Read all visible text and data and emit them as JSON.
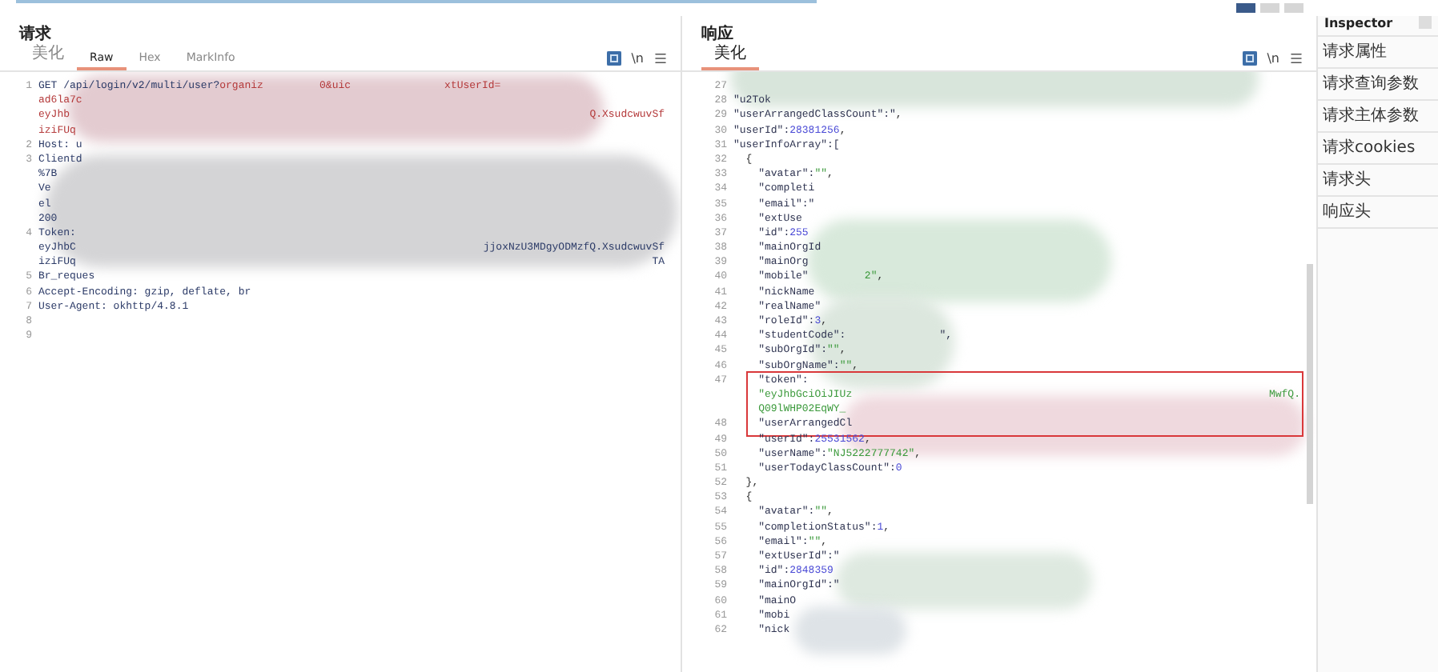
{
  "request": {
    "title": "请求",
    "tabs": [
      {
        "label": "美化",
        "selected": false
      },
      {
        "label": "Raw",
        "selected": true
      },
      {
        "label": "Hex",
        "selected": false
      },
      {
        "label": "MarkInfo",
        "selected": false
      }
    ],
    "toolbar": {
      "newline_toggle": "\\n"
    },
    "rows": [
      {
        "number": "1",
        "parts": [
          {
            "kind": "plain",
            "text": "GET /api/login/v2/multi/user?"
          },
          {
            "kind": "red",
            "text": "organiz         0&uic               xtUserId="
          }
        ]
      },
      {
        "parts": [
          {
            "kind": "red",
            "text": "ad6la7c"
          }
        ]
      },
      {
        "parts": [
          {
            "kind": "red",
            "text": "eyJhb"
          }
        ],
        "tail": {
          "kind": "red",
          "text": "Q.XsudcwuvSf"
        }
      },
      {
        "parts": [
          {
            "kind": "red",
            "text": "iziFUq"
          }
        ]
      },
      {
        "number": "2",
        "parts": [
          {
            "kind": "plain",
            "text": "Host: u"
          }
        ]
      },
      {
        "number": "3",
        "parts": [
          {
            "kind": "plain",
            "text": "Clientd"
          }
        ]
      },
      {
        "parts": [
          {
            "kind": "plain",
            "text": "%7B"
          }
        ]
      },
      {
        "parts": [
          {
            "kind": "plain",
            "text": "Ve"
          }
        ]
      },
      {
        "parts": [
          {
            "kind": "plain",
            "text": "el"
          }
        ]
      },
      {
        "parts": [
          {
            "kind": "plain",
            "text": "200"
          }
        ]
      },
      {
        "number": "4",
        "parts": [
          {
            "kind": "plain",
            "text": "Token:"
          }
        ]
      },
      {
        "parts": [
          {
            "kind": "plain",
            "text": "eyJhbC"
          }
        ],
        "tail": {
          "kind": "plain",
          "text": "jjoxNzU3MDgyODMzfQ.XsudcwuvSf"
        }
      },
      {
        "parts": [
          {
            "kind": "plain",
            "text": "iziFUq"
          }
        ],
        "tail": {
          "kind": "plain",
          "text": "TA"
        }
      },
      {
        "number": "5",
        "parts": [
          {
            "kind": "plain",
            "text": "Br_reques"
          }
        ]
      },
      {
        "number": "6",
        "parts": [
          {
            "kind": "plain",
            "text": "Accept-Encoding: gzip, deflate, br"
          }
        ]
      },
      {
        "number": "7",
        "parts": [
          {
            "kind": "plain",
            "text": "User-Agent: okhttp/4.8.1"
          }
        ]
      },
      {
        "number": "8"
      },
      {
        "number": "9"
      }
    ]
  },
  "response": {
    "title": "响应",
    "tabs": [
      {
        "label": "美化",
        "selected": true
      }
    ],
    "toolbar": {
      "newline_toggle": "\\n"
    },
    "rows": [
      {
        "number": "27"
      },
      {
        "number": "28",
        "parts": [
          {
            "kind": "key",
            "text": "\"u2Tok"
          }
        ]
      },
      {
        "number": "29",
        "parts": [
          {
            "kind": "key",
            "text": "\"userArrangedClassCount\":\""
          },
          {
            "kind": "punct",
            "text": ","
          }
        ]
      },
      {
        "number": "30",
        "parts": [
          {
            "kind": "key",
            "text": "\"userId\":"
          },
          {
            "kind": "num",
            "text": "28381256"
          },
          {
            "kind": "punct",
            "text": ","
          }
        ]
      },
      {
        "number": "31",
        "parts": [
          {
            "kind": "key",
            "text": "\"userInfoArray\":["
          }
        ]
      },
      {
        "number": "32",
        "parts": [
          {
            "kind": "punct",
            "text": "  {"
          }
        ]
      },
      {
        "number": "33",
        "parts": [
          {
            "kind": "key",
            "text": "    \"avatar\":"
          },
          {
            "kind": "str",
            "text": "\"\""
          },
          {
            "kind": "punct",
            "text": ","
          }
        ]
      },
      {
        "number": "34",
        "parts": [
          {
            "kind": "key",
            "text": "    \"completi"
          }
        ]
      },
      {
        "number": "35",
        "parts": [
          {
            "kind": "key",
            "text": "    \"email\":\""
          }
        ]
      },
      {
        "number": "36",
        "parts": [
          {
            "kind": "key",
            "text": "    \"extUse"
          }
        ]
      },
      {
        "number": "37",
        "parts": [
          {
            "kind": "key",
            "text": "    \"id\":"
          },
          {
            "kind": "num",
            "text": "255"
          }
        ]
      },
      {
        "number": "38",
        "parts": [
          {
            "kind": "key",
            "text": "    \"mainOrgId"
          }
        ]
      },
      {
        "number": "39",
        "parts": [
          {
            "kind": "key",
            "text": "    \"mainOrg"
          }
        ]
      },
      {
        "number": "40",
        "parts": [
          {
            "kind": "key",
            "text": "    \"mobile\"         "
          },
          {
            "kind": "str",
            "text": "2\""
          },
          {
            "kind": "punct",
            "text": ","
          }
        ]
      },
      {
        "number": "41",
        "parts": [
          {
            "kind": "key",
            "text": "    \"nickName"
          }
        ]
      },
      {
        "number": "42",
        "parts": [
          {
            "kind": "key",
            "text": "    \"realName\""
          }
        ]
      },
      {
        "number": "43",
        "parts": [
          {
            "kind": "key",
            "text": "    \"roleId\":"
          },
          {
            "kind": "num",
            "text": "3"
          },
          {
            "kind": "punct",
            "text": ","
          }
        ]
      },
      {
        "number": "44",
        "parts": [
          {
            "kind": "key",
            "text": "    \"studentCode\":               \","
          }
        ]
      },
      {
        "number": "45",
        "parts": [
          {
            "kind": "key",
            "text": "    \"subOrgId\":"
          },
          {
            "kind": "str",
            "text": "\"\""
          },
          {
            "kind": "punct",
            "text": ","
          }
        ]
      },
      {
        "number": "46",
        "parts": [
          {
            "kind": "key",
            "text": "    \"subOrgName\":"
          },
          {
            "kind": "str",
            "text": "\"\""
          },
          {
            "kind": "punct",
            "text": ","
          }
        ]
      },
      {
        "number": "47",
        "parts": [
          {
            "kind": "key",
            "text": "    \"token\":"
          }
        ],
        "highlight": true
      },
      {
        "parts": [
          {
            "kind": "str",
            "text": "    \"eyJhbGciOiJIUz"
          }
        ],
        "tail": {
          "kind": "str",
          "text": "MwfQ."
        },
        "highlight": true
      },
      {
        "parts": [
          {
            "kind": "str",
            "text": "    Q09lWHP02EqWY_"
          }
        ],
        "highlight": true
      },
      {
        "number": "48",
        "parts": [
          {
            "kind": "key",
            "text": "    \"userArrangedCl"
          }
        ],
        "highlight": true
      },
      {
        "number": "49",
        "parts": [
          {
            "kind": "key",
            "text": "    \"userId\":"
          },
          {
            "kind": "num",
            "text": "25531562"
          },
          {
            "kind": "punct",
            "text": ","
          }
        ]
      },
      {
        "number": "50",
        "parts": [
          {
            "kind": "key",
            "text": "    \"userName\":"
          },
          {
            "kind": "str",
            "text": "\"NJ5222777742\""
          },
          {
            "kind": "punct",
            "text": ","
          }
        ]
      },
      {
        "number": "51",
        "parts": [
          {
            "kind": "key",
            "text": "    \"userTodayClassCount\":"
          },
          {
            "kind": "num",
            "text": "0"
          }
        ]
      },
      {
        "number": "52",
        "parts": [
          {
            "kind": "punct",
            "text": "  },"
          }
        ]
      },
      {
        "number": "53",
        "parts": [
          {
            "kind": "punct",
            "text": "  {"
          }
        ]
      },
      {
        "number": "54",
        "parts": [
          {
            "kind": "key",
            "text": "    \"avatar\":"
          },
          {
            "kind": "str",
            "text": "\"\""
          },
          {
            "kind": "punct",
            "text": ","
          }
        ]
      },
      {
        "number": "55",
        "parts": [
          {
            "kind": "key",
            "text": "    \"completionStatus\":"
          },
          {
            "kind": "num",
            "text": "1"
          },
          {
            "kind": "punct",
            "text": ","
          }
        ]
      },
      {
        "number": "56",
        "parts": [
          {
            "kind": "key",
            "text": "    \"email\":"
          },
          {
            "kind": "str",
            "text": "\"\""
          },
          {
            "kind": "punct",
            "text": ","
          }
        ]
      },
      {
        "number": "57",
        "parts": [
          {
            "kind": "key",
            "text": "    \"extUserId\":\""
          }
        ]
      },
      {
        "number": "58",
        "parts": [
          {
            "kind": "key",
            "text": "    \"id\":"
          },
          {
            "kind": "num",
            "text": "2848359"
          }
        ]
      },
      {
        "number": "59",
        "parts": [
          {
            "kind": "key",
            "text": "    \"mainOrgId\":\""
          }
        ]
      },
      {
        "number": "60",
        "parts": [
          {
            "kind": "key",
            "text": "    \"mainO"
          }
        ]
      },
      {
        "number": "61",
        "parts": [
          {
            "kind": "key",
            "text": "    \"mobi"
          }
        ]
      },
      {
        "number": "62",
        "parts": [
          {
            "kind": "key",
            "text": "    \"nick"
          }
        ]
      }
    ]
  },
  "inspector": {
    "title": "Inspector",
    "items": [
      "请求属性",
      "请求查询参数",
      "请求主体参数",
      "请求cookies",
      "请求头",
      "响应头"
    ]
  }
}
